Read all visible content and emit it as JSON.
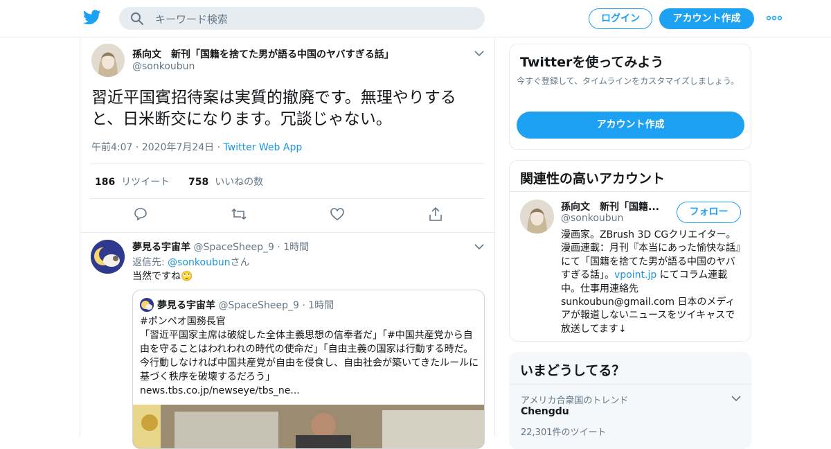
{
  "topbar": {
    "search_placeholder": "キーワード検索",
    "login_label": "ログイン",
    "signup_label": "アカウント作成"
  },
  "tweet": {
    "author_name": "孫向文　新刊「国籍を捨てた男が語る中国のヤバすぎる話」",
    "author_handle": "@sonkoubun",
    "text": "習近平国賓招待案は実質的撤廃です。無理やりすると、日米断交になります。冗談じゃない。",
    "time": "午前4:07",
    "date": "2020年7月24日",
    "source": "Twitter Web App",
    "retweet_count": "186",
    "retweet_label": "リツイート",
    "like_count": "758",
    "like_label": "いいねの数"
  },
  "reply": {
    "author_name": "夢見る宇宙羊",
    "author_handle": "@SpaceSheep_9",
    "time": "1時間",
    "replying_to_label": "返信先:",
    "replying_to_handle": "@sonkoubun",
    "replying_to_suffix": "さん",
    "text": "当然ですね🙄",
    "quote": {
      "author_name": "夢見る宇宙羊",
      "author_handle": "@SpaceSheep_9",
      "time": "1時間",
      "line1": "#ポンペオ国務長官",
      "line2": "「習近平国家主席は破綻した全体主義思想の信奉者だ」「#中国共産党から自由を守ることはわれわれの時代の使命だ」「自由主義の国家は行動する時だ。今行動しなければ中国共産党が自由を侵食し、自由社会が築いてきたルールに基づく秩序を破壊するだろう」",
      "url": "news.tbs.co.jp/newseye/tbs_ne..."
    }
  },
  "sidebar": {
    "try_twitter": {
      "title": "Twitterを使ってみよう",
      "description": "今すぐ登録して、タイムラインをカスタマイズしましょう。",
      "button": "アカウント作成"
    },
    "related": {
      "title": "関連性の高いアカウント",
      "name": "孫向文　新刊「国籍...",
      "handle": "@sonkoubun",
      "follow_label": "フォロー",
      "bio_part1": "漫画家。ZBrush 3D CGクリエイター。漫画連載：月刊『本当にあった愉快な話』にて「国籍を捨てた男が語る中国のヤバすぎる話」。",
      "bio_link": "vpoint.jp",
      "bio_part2": " にてコラム連載中。仕事用連絡先 sunkoubun@gmail.com 日本のメディアが報道しないニュースをツイキャスで放送してます↓"
    },
    "trends": {
      "title": "いまどうしてる？",
      "context": "アメリカ合衆国のトレンド",
      "topic": "Chengdu",
      "count": "22,301件のツイート"
    }
  },
  "colors": {
    "accent": "#1da1f2",
    "link": "#1b95e0",
    "muted": "#657786",
    "border": "#e6ecf0"
  }
}
